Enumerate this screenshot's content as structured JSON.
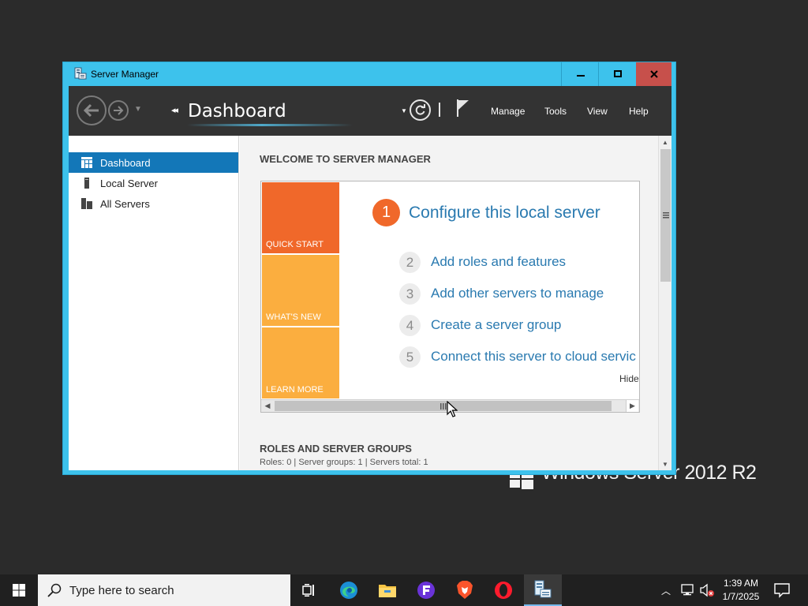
{
  "desktop": {
    "watermark": "Windows Server 2012 R2"
  },
  "window": {
    "title": "Server Manager",
    "controls": {
      "minimize": "▬",
      "maximize": "☐",
      "close": "✕"
    }
  },
  "header": {
    "breadcrumb_title": "Dashboard",
    "menu": {
      "manage": "Manage",
      "tools": "Tools",
      "view": "View",
      "help": "Help"
    }
  },
  "sidebar": {
    "items": [
      {
        "label": "Dashboard",
        "icon": "dashboard-icon",
        "active": true
      },
      {
        "label": "Local Server",
        "icon": "server-icon",
        "active": false
      },
      {
        "label": "All Servers",
        "icon": "servers-icon",
        "active": false
      }
    ]
  },
  "main": {
    "welcome_heading": "WELCOME TO SERVER MANAGER",
    "tiles": {
      "quick_start": "QUICK START",
      "whats_new": "WHAT'S NEW",
      "learn_more": "LEARN MORE"
    },
    "steps": [
      {
        "num": "1",
        "label": "Configure this local server"
      },
      {
        "num": "2",
        "label": "Add roles and features"
      },
      {
        "num": "3",
        "label": "Add other servers to manage"
      },
      {
        "num": "4",
        "label": "Create a server group"
      },
      {
        "num": "5",
        "label": "Connect this server to cloud servic"
      }
    ],
    "hide_link": "Hide",
    "roles_heading": "ROLES AND SERVER GROUPS",
    "roles_summary": "Roles: 0   |   Server groups: 1   |   Servers total: 1"
  },
  "taskbar": {
    "search_placeholder": "Type here to search",
    "clock_time": "1:39 AM",
    "clock_date": "1/7/2025"
  },
  "colors": {
    "window_frame": "#3dc2ec",
    "header_bg": "#333333",
    "active_nav": "#1377b8",
    "quick_start": "#f0682a",
    "tile_yellow": "#fbae3f",
    "link_blue": "#2a7ab0",
    "close_red": "#c7504b"
  }
}
